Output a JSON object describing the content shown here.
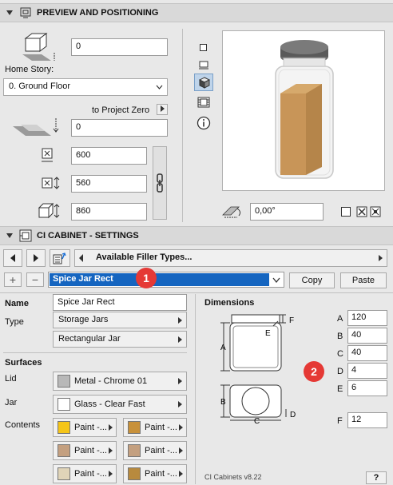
{
  "preview": {
    "header": "PREVIEW AND POSITIONING",
    "elevation_value": "0",
    "home_story_label": "Home Story:",
    "home_story_value": "0. Ground Floor",
    "to_project_zero_label": "to Project Zero",
    "project_zero_value": "0",
    "width_value": "600",
    "depth_value": "560",
    "height_value": "860",
    "angle_value": "0,00°"
  },
  "settings": {
    "header": "CI CABINET - SETTINGS",
    "filler_types_label": "Available Filler Types...",
    "selected_type": "Spice Jar Rect",
    "copy_label": "Copy",
    "paste_label": "Paste",
    "name_label": "Name",
    "name_value": "Spice Jar Rect",
    "type_label": "Type",
    "type_value_1": "Storage Jars",
    "type_value_2": "Rectangular Jar",
    "surfaces_label": "Surfaces",
    "lid_label": "Lid",
    "lid_value": "Metal - Chrome 01",
    "jar_label": "Jar",
    "jar_value": "Glass - Clear Fast",
    "contents_label": "Contents",
    "contents": [
      "Paint -...",
      "Paint -...",
      "Paint -...",
      "Paint -...",
      "Paint -...",
      "Paint -..."
    ],
    "contents_colors": [
      "#f5c518",
      "#c8913a",
      "#c4a080",
      "#c4a080",
      "#e0d4b8",
      "#b88a3e"
    ],
    "dimensions_label": "Dimensions",
    "dim_letters": [
      "A",
      "B",
      "C",
      "D",
      "E",
      "F"
    ],
    "dim_values": [
      "120",
      "40",
      "40",
      "4",
      "6",
      "12"
    ],
    "version": "CI Cabinets v8.22",
    "help": "?",
    "badge1": "1",
    "badge2": "2"
  },
  "colors": {
    "selected_bg": "#1565c0",
    "badge": "#e53935",
    "lid_swatch": "#b8b8b8",
    "jar_swatch": "#ffffff"
  },
  "icons": [
    "preview-icon",
    "box-icon",
    "floor-plane-icon",
    "width-icon",
    "depth-icon",
    "height-icon",
    "link-icon",
    "angle-icon",
    "cabinet-icon",
    "arrow-left-icon",
    "arrow-right-icon",
    "filler-icon",
    "plus-icon",
    "minus-icon",
    "help-icon"
  ]
}
